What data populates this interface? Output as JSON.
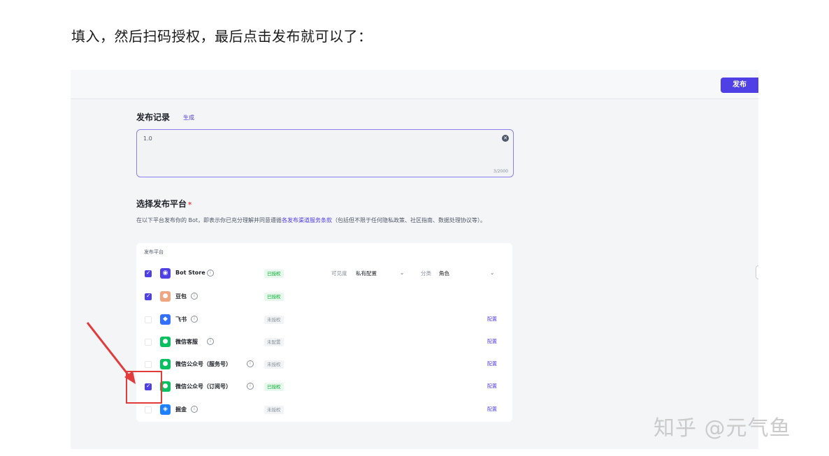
{
  "article": {
    "caption": "填入，然后扫码授权，最后点击发布就可以了："
  },
  "topbar": {
    "publish_label": "发布"
  },
  "record": {
    "title": "发布记录",
    "generate_label": "生成",
    "value": "1.0",
    "counter": "3/2000"
  },
  "platform_section": {
    "title": "选择发布平台",
    "required_mark": "*",
    "desc_prefix": "在以下平台发布你的 Bot，即表示你已充分理解并同意遵循",
    "terms_link": "各发布渠道服务条款",
    "desc_suffix": "（包括但不限于任何隐私政策、社区指南、数据处理协议等）。",
    "column_header": "发布平台",
    "visibility_label": "可见度",
    "visibility_value": "私有配置",
    "category_label": "分类",
    "category_value": "角色",
    "configure_label": "配置"
  },
  "platforms": [
    {
      "name": "Bot Store",
      "status": "已授权",
      "authorized": true,
      "checked": true,
      "icon": "bot-store-icon",
      "color": "#4e40e5"
    },
    {
      "name": "豆包",
      "status": "已授权",
      "authorized": true,
      "checked": true,
      "icon": "doubao-icon",
      "color": "#f0a680"
    },
    {
      "name": "飞书",
      "status": "未授权",
      "authorized": false,
      "checked": false,
      "icon": "feishu-icon",
      "color": "#3370ff"
    },
    {
      "name": "微信客服",
      "status": "未配置",
      "authorized": false,
      "checked": false,
      "icon": "wechat-icon",
      "color": "#07c160"
    },
    {
      "name": "微信公众号（服务号）",
      "status": "未授权",
      "authorized": false,
      "checked": false,
      "icon": "wechat-icon",
      "color": "#07c160"
    },
    {
      "name": "微信公众号（订阅号）",
      "status": "已授权",
      "authorized": true,
      "checked": true,
      "icon": "wechat-icon",
      "color": "#07c160"
    },
    {
      "name": "掘金",
      "status": "未授权",
      "authorized": false,
      "checked": false,
      "icon": "juejin-icon",
      "color": "#1e80ff"
    }
  ],
  "watermark": "知乎 @元气鱼",
  "annotation_color": "#e23b3b"
}
